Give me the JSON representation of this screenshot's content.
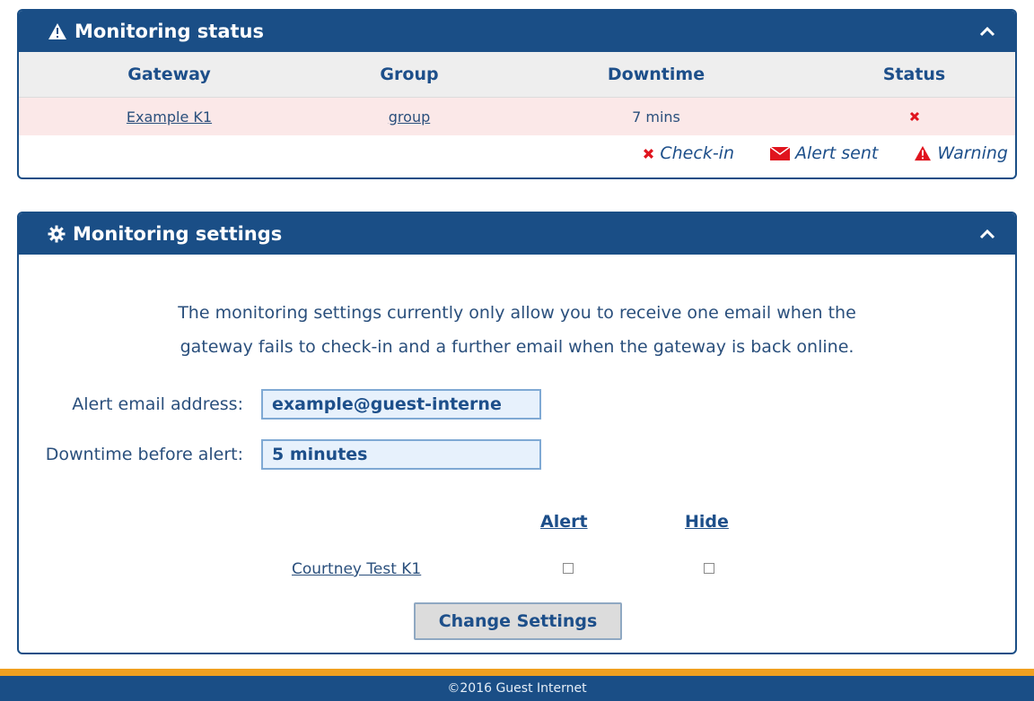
{
  "status_panel": {
    "title": "Monitoring status",
    "columns": [
      "Gateway",
      "Group",
      "Downtime",
      "Status"
    ],
    "rows": [
      {
        "gateway": "Example K1",
        "group": "group",
        "downtime": "7 mins",
        "status_icon": "x-icon"
      }
    ],
    "legend": [
      {
        "icon": "x-icon",
        "label": "Check-in"
      },
      {
        "icon": "envelope-icon",
        "label": "Alert sent"
      },
      {
        "icon": "warning-icon",
        "label": "Warning"
      }
    ]
  },
  "settings_panel": {
    "title": "Monitoring settings",
    "description_line1": "The monitoring settings currently only allow you to receive one email when the",
    "description_line2": "gateway fails to check-in and a further email when the gateway is back online.",
    "email_label": "Alert email address:",
    "email_value": "example@guest-interne",
    "downtime_label": "Downtime before alert:",
    "downtime_value": "5 minutes",
    "col_alert": "Alert",
    "col_hide": "Hide",
    "gateway_name": "Courtney Test K1",
    "button_label": "Change Settings"
  },
  "footer": {
    "text": "©2016 Guest Internet"
  },
  "colors": {
    "header": "#1a4e86",
    "accent": "#f0a020",
    "error": "#e0141e",
    "row_error_bg": "#fbe8e8"
  }
}
